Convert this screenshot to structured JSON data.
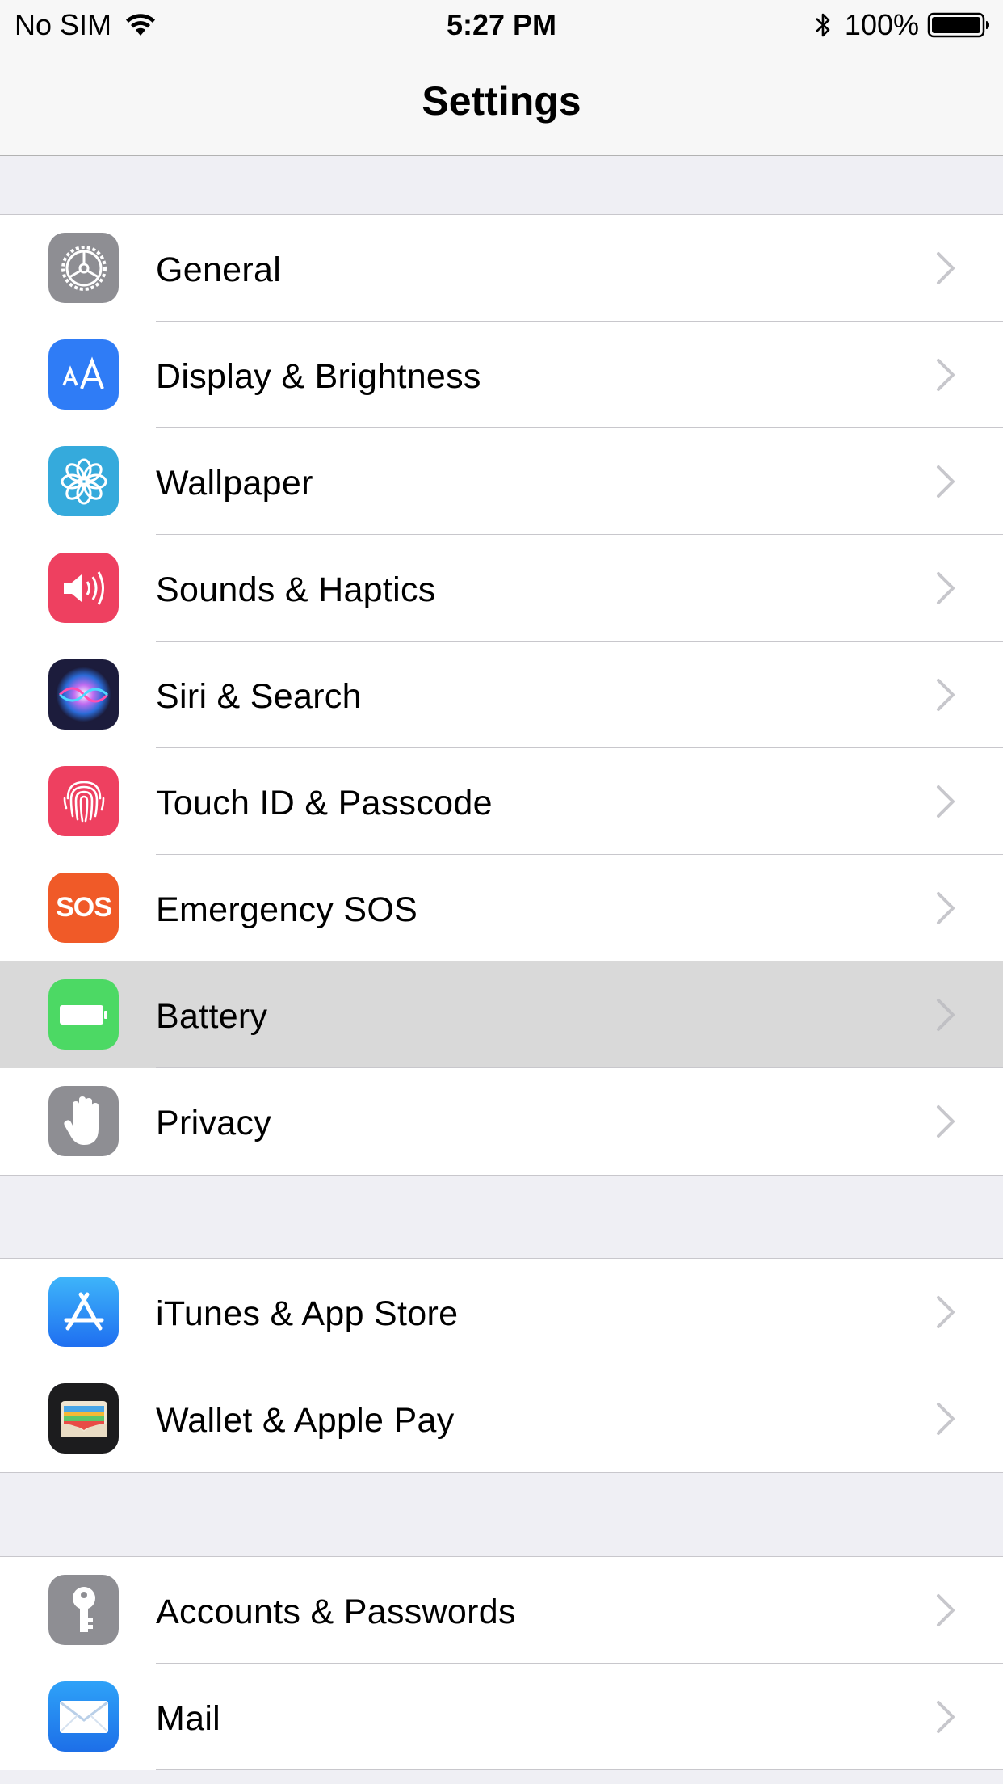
{
  "status_bar": {
    "carrier": "No SIM",
    "time": "5:27 PM",
    "battery": "100%"
  },
  "nav": {
    "title": "Settings"
  },
  "groups": [
    {
      "items": [
        {
          "label": "General",
          "icon": "gear-icon",
          "color": "#8e8e93"
        },
        {
          "label": "Display & Brightness",
          "icon": "text-size-icon",
          "color": "#2f7cf6"
        },
        {
          "label": "Wallpaper",
          "icon": "flower-icon",
          "color": "#35aadc"
        },
        {
          "label": "Sounds & Haptics",
          "icon": "speaker-icon",
          "color": "#ee4060"
        },
        {
          "label": "Siri & Search",
          "icon": "siri-icon",
          "color": "#1c1c3c"
        },
        {
          "label": "Touch ID & Passcode",
          "icon": "fingerprint-icon",
          "color": "#ee4060"
        },
        {
          "label": "Emergency SOS",
          "icon": "sos-icon",
          "color": "#f05a28",
          "icon_text": "SOS"
        },
        {
          "label": "Battery",
          "icon": "battery-icon",
          "color": "#4cd964",
          "highlighted": true
        },
        {
          "label": "Privacy",
          "icon": "hand-icon",
          "color": "#8e8e93"
        }
      ]
    },
    {
      "items": [
        {
          "label": "iTunes & App Store",
          "icon": "app-store-icon",
          "color": "#2f8cf6"
        },
        {
          "label": "Wallet & Apple Pay",
          "icon": "wallet-icon",
          "color": "#1c1c1e"
        }
      ]
    },
    {
      "items": [
        {
          "label": "Accounts & Passwords",
          "icon": "key-icon",
          "color": "#8e8e93"
        },
        {
          "label": "Mail",
          "icon": "mail-icon",
          "color": "#2f8cf6"
        }
      ]
    }
  ]
}
